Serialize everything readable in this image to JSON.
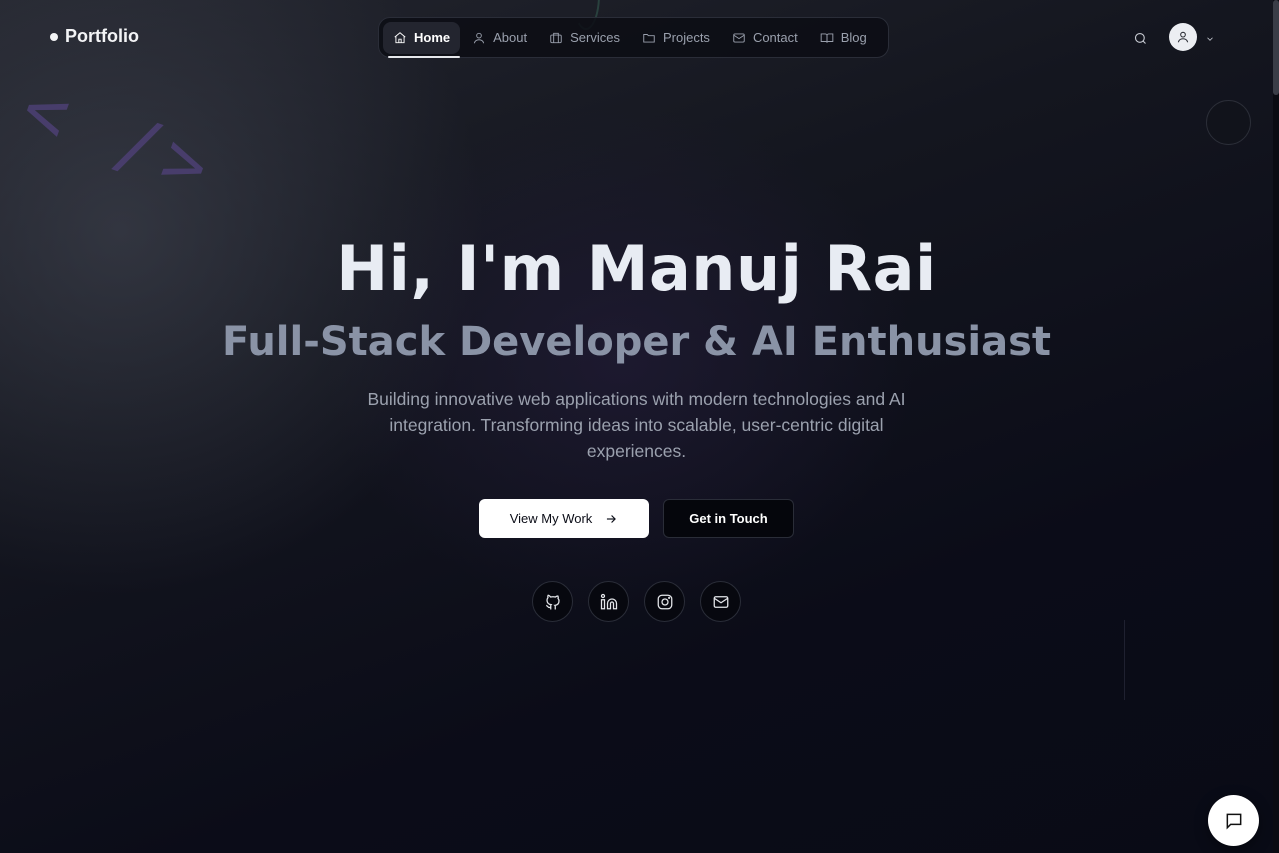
{
  "brand": {
    "logo_text": "Portfolio"
  },
  "nav": {
    "items": [
      {
        "label": "Home",
        "icon": "home-icon",
        "active": true
      },
      {
        "label": "About",
        "icon": "user-icon",
        "active": false
      },
      {
        "label": "Services",
        "icon": "briefcase-icon",
        "active": false
      },
      {
        "label": "Projects",
        "icon": "folder-icon",
        "active": false
      },
      {
        "label": "Contact",
        "icon": "mail-icon",
        "active": false
      },
      {
        "label": "Blog",
        "icon": "book-open-icon",
        "active": false
      }
    ]
  },
  "header_actions": {
    "search_icon": "search-icon",
    "avatar_icon": "user-icon",
    "menu_icon": "chevron-down-icon"
  },
  "decorations": {
    "code_symbol": "< />"
  },
  "hero": {
    "title": "Hi, I'm Manuj Rai",
    "subtitle": "Full-Stack Developer & AI Enthusiast",
    "description": "Building innovative web applications with modern technologies and AI integration. Transforming ideas into scalable, user-centric digital experiences.",
    "primary_cta": "View My Work",
    "secondary_cta": "Get in Touch"
  },
  "social": [
    {
      "name": "github",
      "icon": "github-icon"
    },
    {
      "name": "linkedin",
      "icon": "linkedin-icon"
    },
    {
      "name": "instagram",
      "icon": "instagram-icon"
    },
    {
      "name": "email",
      "icon": "mail-icon"
    }
  ],
  "chat": {
    "icon": "chat-bubble-icon"
  },
  "colors": {
    "background": "#0b0d17",
    "title": "#e8ecf3",
    "subtitle": "#8a93a6",
    "accent_code": "#4b3f71"
  }
}
